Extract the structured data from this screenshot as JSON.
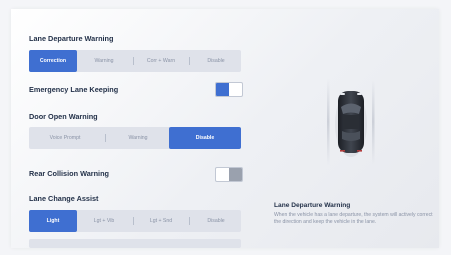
{
  "sections": {
    "lane_departure": {
      "title": "Lane Departure Warning",
      "options": [
        "Correction",
        "Warning",
        "Corr + Warn",
        "Disable"
      ],
      "selected": "Correction"
    },
    "emergency_lane": {
      "title": "Emergency Lane Keeping",
      "enabled": true
    },
    "door_open": {
      "title": "Door Open Warning",
      "options": [
        "Voice Prompt",
        "Warning",
        "Disable"
      ],
      "selected": "Disable"
    },
    "rear_collision": {
      "title": "Rear Collision Warning",
      "enabled": false
    },
    "lane_change": {
      "title": "Lane Change Assist",
      "options": [
        "Light",
        "Lgt + Vib",
        "Lgt + Snd",
        "Disable"
      ],
      "selected": "Light"
    }
  },
  "info": {
    "title": "Lane Departure Warning",
    "description": "When the vehicle has a lane departure, the system will actively correct the direction and keep the vehicle in the lane."
  },
  "colors": {
    "accent": "#3f6fd1",
    "heading": "#24324a",
    "muted": "#8a93a6"
  },
  "icons": {
    "car": "car-top-view-icon"
  }
}
